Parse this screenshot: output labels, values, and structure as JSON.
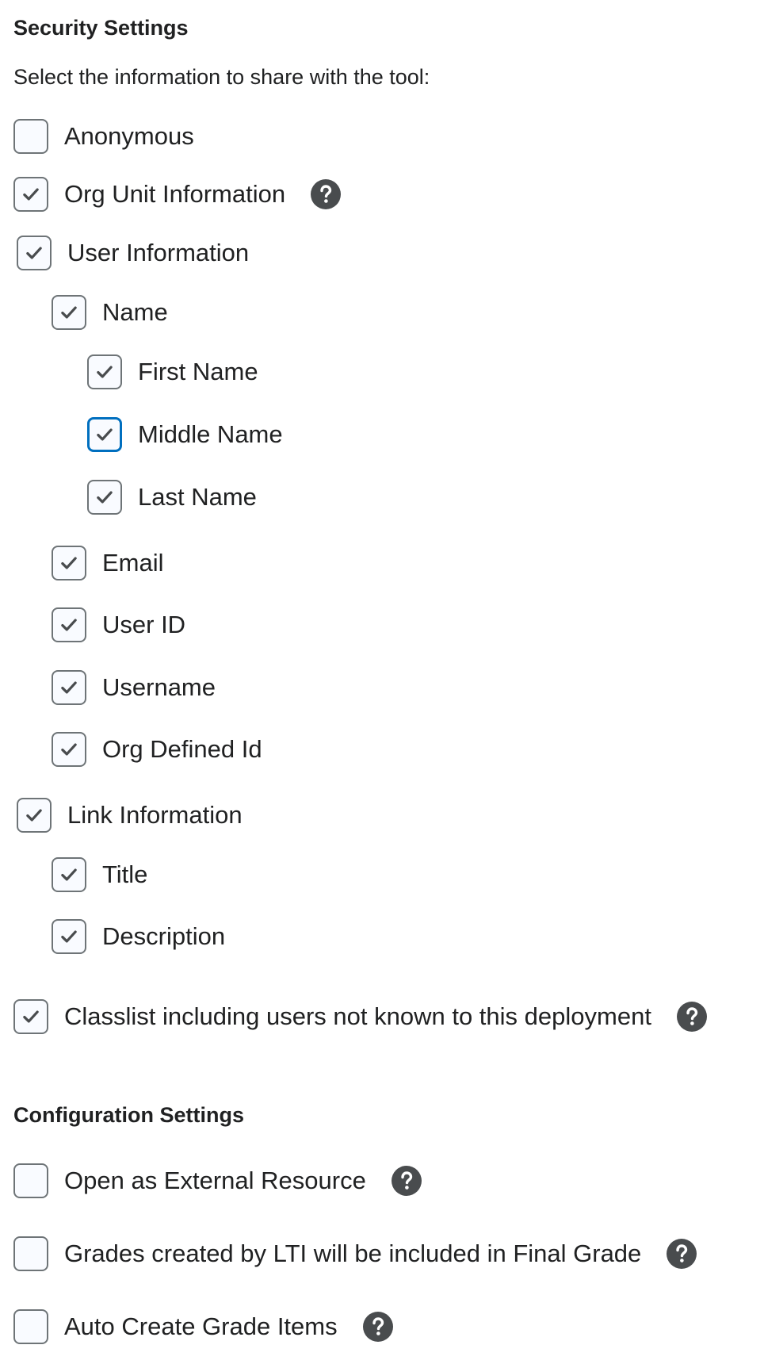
{
  "security": {
    "title": "Security Settings",
    "instruction": "Select the information to share with the tool:",
    "items": [
      {
        "label": "Anonymous",
        "checked": false
      },
      {
        "label": "Org Unit Information",
        "checked": true,
        "help": true
      },
      {
        "label": "User Information",
        "checked": true
      },
      {
        "label": "Name",
        "checked": true
      },
      {
        "label": "First Name",
        "checked": true
      },
      {
        "label": "Middle Name",
        "checked": true,
        "focused": true
      },
      {
        "label": "Last Name",
        "checked": true
      },
      {
        "label": "Email",
        "checked": true
      },
      {
        "label": "User ID",
        "checked": true
      },
      {
        "label": "Username",
        "checked": true
      },
      {
        "label": "Org Defined Id",
        "checked": true
      },
      {
        "label": "Link Information",
        "checked": true
      },
      {
        "label": "Title",
        "checked": true
      },
      {
        "label": "Description",
        "checked": true
      },
      {
        "label": "Classlist including users not known to this deployment",
        "checked": true,
        "help": true
      }
    ]
  },
  "configuration": {
    "title": "Configuration Settings",
    "items": [
      {
        "label": "Open as External Resource",
        "checked": false,
        "help": true
      },
      {
        "label": "Grades created by LTI will be included in Final Grade",
        "checked": false,
        "help": true
      },
      {
        "label": "Auto Create Grade Items",
        "checked": false,
        "help": true
      }
    ]
  },
  "colors": {
    "text": "#202122",
    "checkbox_border": "#6e7477",
    "checkbox_focus": "#006fbf",
    "help_icon_bg": "#494c4e"
  }
}
